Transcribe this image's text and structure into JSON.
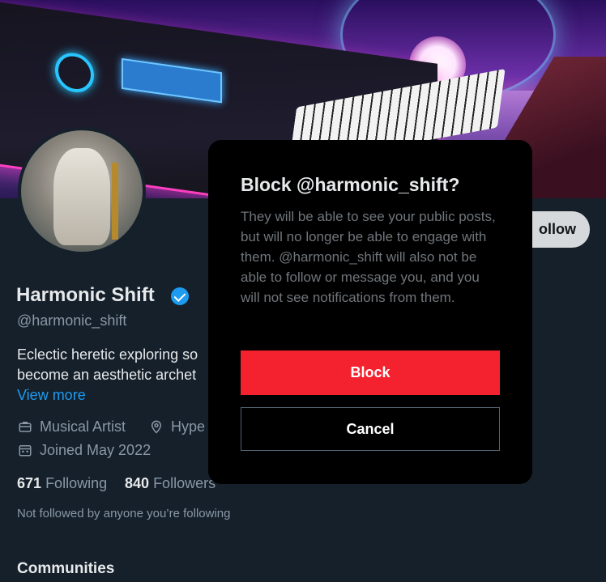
{
  "profile": {
    "name": "Harmonic Shift",
    "handle": "@harmonic_shift",
    "bio": "Eclectic heretic exploring so become an aesthetic archet",
    "bio_line1": "Eclectic heretic exploring so",
    "bio_line2": "become an aesthetic archet",
    "view_more": "View more",
    "category": "Musical Artist",
    "location": "Hype",
    "joined": "Joined May 2022",
    "following_count": "671",
    "following_label": "Following",
    "followers_count": "840",
    "followers_label": "Followers",
    "not_followed": "Not followed by anyone you’re following",
    "follow_button": "ollow"
  },
  "section": {
    "communities": "Communities"
  },
  "modal": {
    "title": "Block @harmonic_shift?",
    "body": "They will be able to see your public posts, but will no longer be able to engage with them. @harmonic_shift will also not be able to follow or message you, and you will not see notifications from them.",
    "block_label": "Block",
    "cancel_label": "Cancel"
  },
  "icons": {
    "category": "briefcase-icon",
    "location": "location-pin-icon",
    "joined": "calendar-icon",
    "verified": "verified-badge-icon"
  },
  "colors": {
    "background": "#15202b",
    "accent": "#1d9bf0",
    "danger": "#f4212e",
    "modal": "#000000"
  }
}
